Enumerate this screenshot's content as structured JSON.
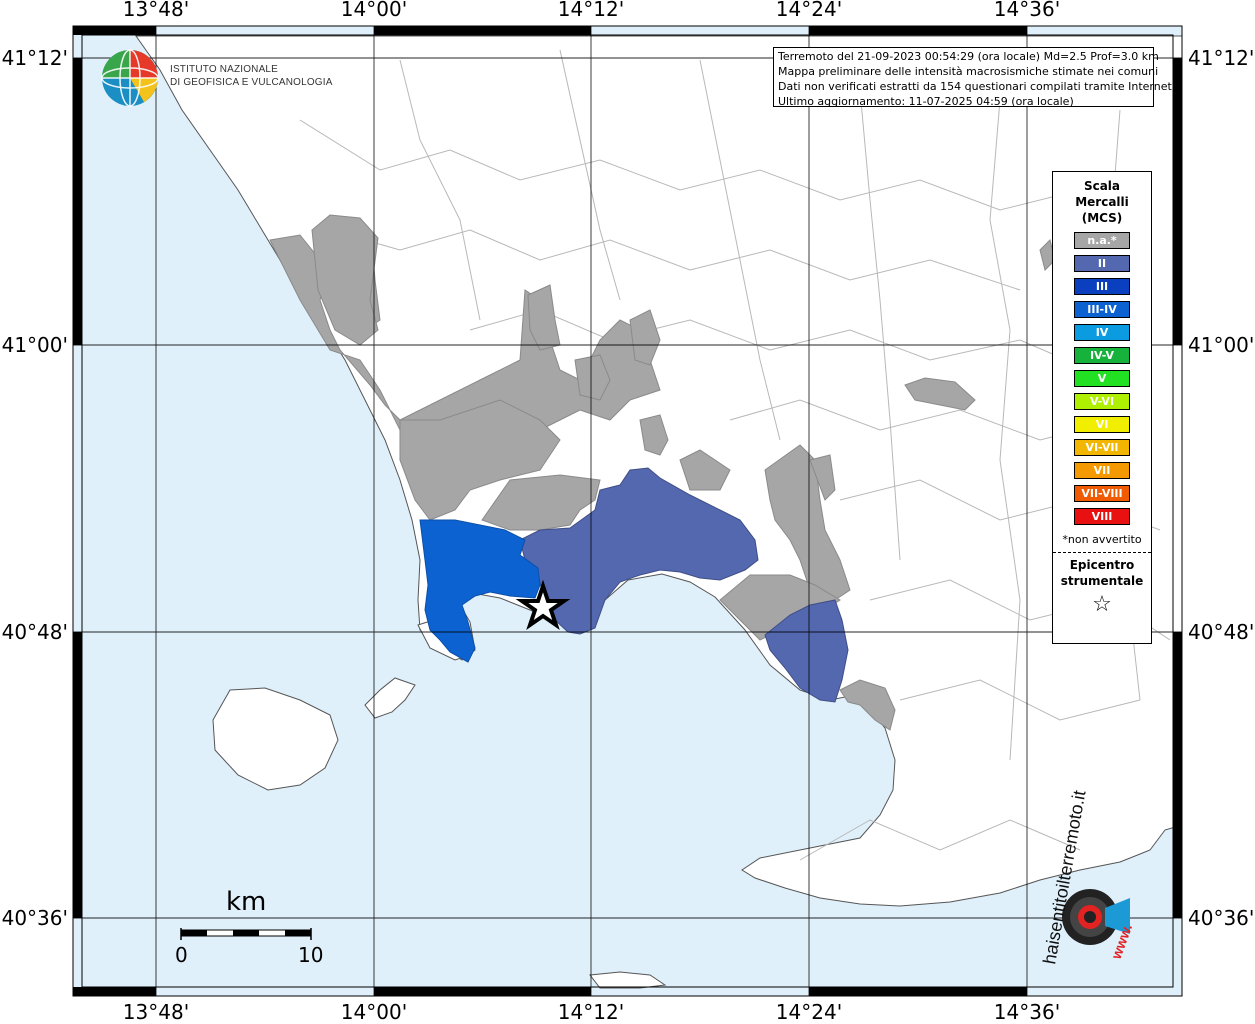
{
  "map": {
    "colors": {
      "sea": "#dff0fb",
      "land": "#ffffff",
      "na": "#a6a6a6",
      "intensity_II": "#5468b0",
      "intensity_III_IV": "#0d62d1",
      "frame": "#000000"
    },
    "lon_ticks_top": [
      "13°48'",
      "14°00'",
      "14°12'",
      "14°24'",
      "14°36'"
    ],
    "lon_ticks_bottom": [
      "13°48'",
      "14°00'",
      "14°12'",
      "14°24'",
      "14°36'"
    ],
    "lat_ticks_left": [
      "41°12'",
      "41°00'",
      "40°48'",
      "40°36'"
    ],
    "lat_ticks_right": [
      "41°12'",
      "41°00'",
      "40°48'",
      "40°36'"
    ]
  },
  "info": {
    "line1": "Terremoto del 21-09-2023 00:54:29 (ora locale) Md=2.5 Prof=3.0 km",
    "line2": "Mappa preliminare delle intensità macrosismiche stimate nei comuni",
    "line3": "Dati non verificati estratti da 154 questionari compilati tramite Internet.",
    "line4": "Ultimo aggiornamento: 11-07-2025 04:59 (ora locale)"
  },
  "logo": {
    "line1": "ISTITUTO NAZIONALE",
    "line2": "DI GEOFISICA E VULCANOLOGIA",
    "haisentito": "haisentitoilterremoto.it",
    "www": "www."
  },
  "legend": {
    "title1": "Scala",
    "title2": "Mercalli",
    "title3": "(MCS)",
    "items": [
      {
        "label": "n.a.*",
        "color": "#a6a6a6"
      },
      {
        "label": "II",
        "color": "#5468b0"
      },
      {
        "label": "III",
        "color": "#0a3fbf"
      },
      {
        "label": "III-IV",
        "color": "#0d62d1"
      },
      {
        "label": "IV",
        "color": "#0a9be0"
      },
      {
        "label": "IV-V",
        "color": "#17b23c"
      },
      {
        "label": "V",
        "color": "#22e022"
      },
      {
        "label": "V-VI",
        "color": "#aef000"
      },
      {
        "label": "VI",
        "color": "#f2ee00"
      },
      {
        "label": "VI-VII",
        "color": "#f2b600"
      },
      {
        "label": "VII",
        "color": "#f49a00"
      },
      {
        "label": "VII-VIII",
        "color": "#f05a00"
      },
      {
        "label": "VIII",
        "color": "#e81010"
      }
    ],
    "note": "*non avvertito",
    "epi1": "Epicentro",
    "epi2": "strumentale",
    "epi_symbol": "☆"
  },
  "scalebar": {
    "unit": "km",
    "start": "0",
    "end": "10"
  }
}
